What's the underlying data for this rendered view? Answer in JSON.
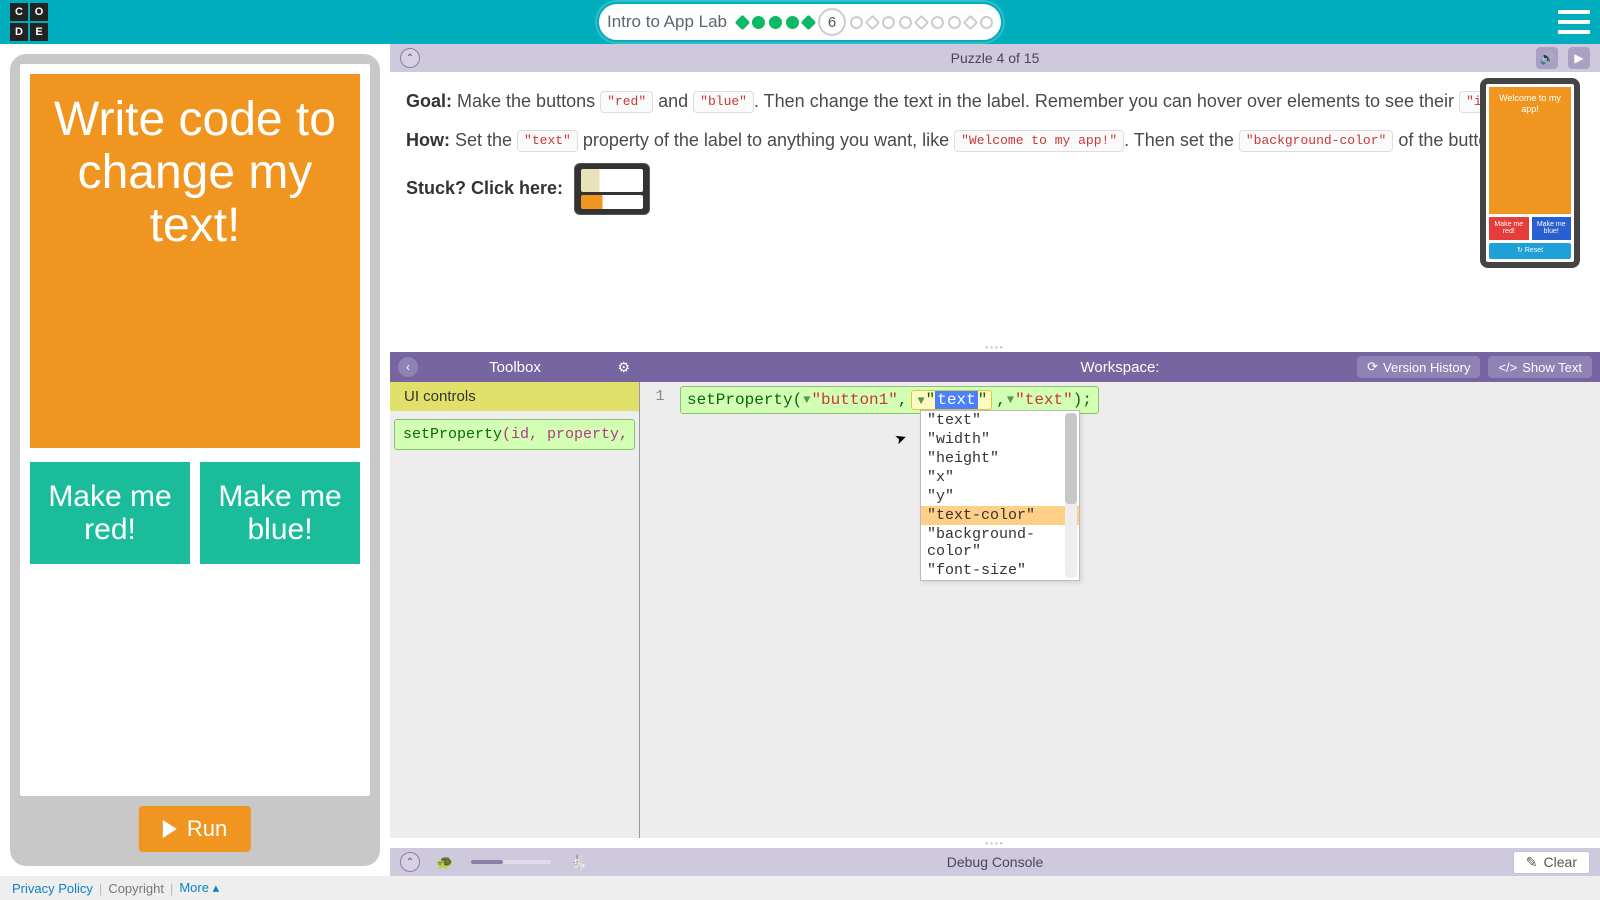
{
  "header": {
    "lesson_title": "Intro to App Lab",
    "current_step": "6",
    "logo_letters": [
      "C",
      "O",
      "D",
      "E"
    ]
  },
  "instructions_bar": {
    "title": "Puzzle 4 of 15"
  },
  "instructions": {
    "goal_label": "Goal:",
    "goal_part1": " Make the buttons ",
    "chip_red": "\"red\"",
    "goal_and": " and ",
    "chip_blue": "\"blue\"",
    "goal_part2": ". Then change the text in the label. Remember you can hover over elements to see their ",
    "chip_id": "\"id\"",
    "how_label": "How:",
    "how_part1": " Set the ",
    "chip_text": "\"text\"",
    "how_part2": " property of the label to anything you want, like ",
    "chip_welcome": "\"Welcome to my app!\"",
    "how_part3": ". Then set the ",
    "chip_bg": "\"background-color\"",
    "how_part4": " of the buttons.",
    "stuck_label": "Stuck? Click here:"
  },
  "mini_phone": {
    "label_text": "Welcome to my app!",
    "btn_red": "Make me red!",
    "btn_blue": "Make me blue!",
    "reset": "↻ Reset"
  },
  "app_preview": {
    "label_text": "Write code to change my text!",
    "btn1": "Make me red!",
    "btn2": "Make me blue!",
    "run": "Run"
  },
  "toolbox": {
    "header": "Toolbox",
    "category": "UI controls",
    "block_fn": "setProperty",
    "block_sig": "(id, property, va"
  },
  "workspace": {
    "header": "Workspace:",
    "version_history": "Version History",
    "show_text": "Show Text",
    "line_no": "1",
    "code_fn": "setProperty",
    "code_arg1": "\"button1\"",
    "code_arg2": "\"text\"",
    "code_arg3": "\"text\"",
    "autocomplete": [
      "\"text\"",
      "\"width\"",
      "\"height\"",
      "\"x\"",
      "\"y\"",
      "\"text-color\"",
      "\"background-color\"",
      "\"font-size\""
    ],
    "autocomplete_highlight_index": 5
  },
  "debug": {
    "title": "Debug Console",
    "clear": "Clear"
  },
  "footer": {
    "privacy": "Privacy Policy",
    "copyright": "Copyright",
    "more": "More ▴"
  }
}
